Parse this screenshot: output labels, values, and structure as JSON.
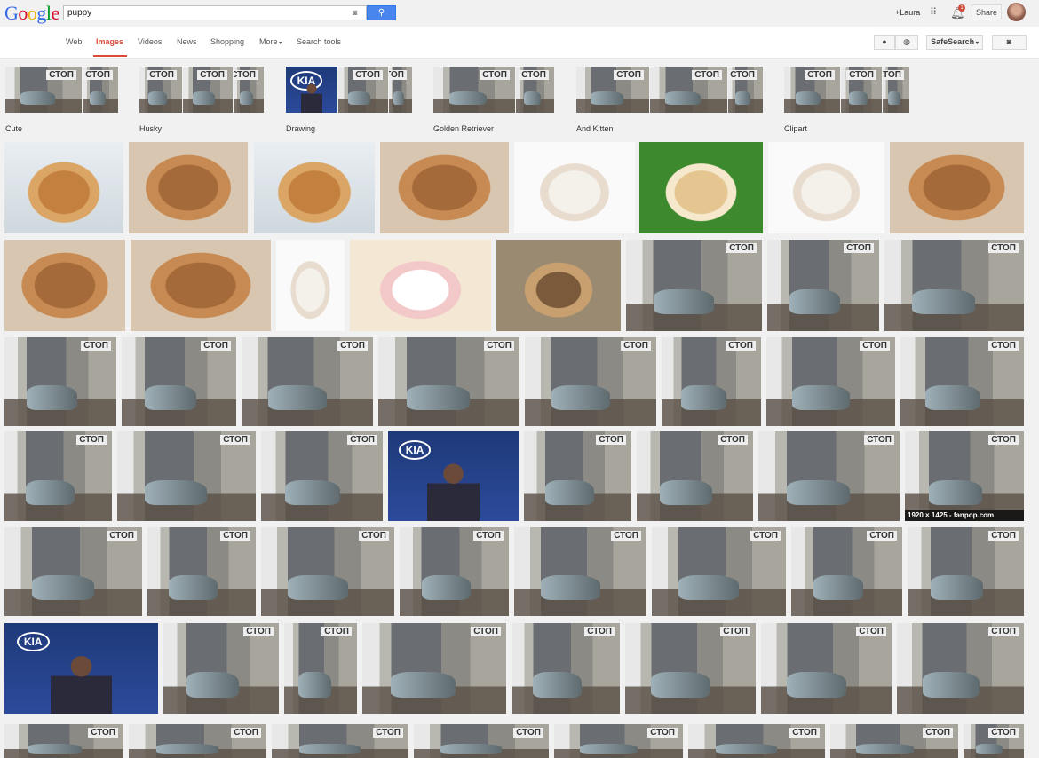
{
  "header": {
    "logo_letters": [
      "G",
      "o",
      "o",
      "g",
      "l",
      "e"
    ],
    "search_value": "puppy",
    "search_button_icon": "search-icon",
    "user_link": "+Laura",
    "notifications_count": "1",
    "share_label": "Share"
  },
  "nav": {
    "tabs": [
      {
        "label": "Web"
      },
      {
        "label": "Images"
      },
      {
        "label": "Videos"
      },
      {
        "label": "News"
      },
      {
        "label": "Shopping"
      },
      {
        "label": "More"
      },
      {
        "label": "Search tools"
      }
    ],
    "active_tab": "Images",
    "safesearch_label": "SafeSearch"
  },
  "suggestions": [
    {
      "label": "Cute"
    },
    {
      "label": "Husky"
    },
    {
      "label": "Drawing"
    },
    {
      "label": "Golden Retriever"
    },
    {
      "label": "And Kitten"
    },
    {
      "label": "Clipart"
    }
  ],
  "hover_caption": "1920 × 1425 - fanpop.com",
  "colors": {
    "accent_red": "#dd4b39",
    "search_blue": "#4885ed",
    "background": "#f1f1f1"
  }
}
